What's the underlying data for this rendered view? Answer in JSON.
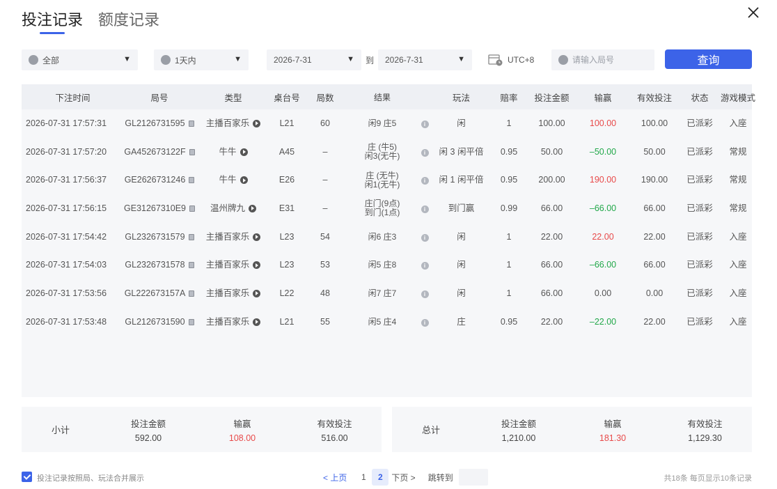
{
  "tabs": [
    {
      "label": "投注记录",
      "active": true
    },
    {
      "label": "额度记录",
      "active": false
    }
  ],
  "filters": {
    "scope": "全部",
    "range": "1天内",
    "start_date": "2026-7-31",
    "to_label": "到",
    "end_date": "2026-7-31",
    "timezone": "UTC+8",
    "search_placeholder": "请输入局号",
    "query_label": "查询"
  },
  "table": {
    "columns": [
      "下注时间",
      "局号",
      "类型",
      "桌台号",
      "局数",
      "结果",
      "玩法",
      "赔率",
      "投注金额",
      "输赢",
      "有效投注",
      "状态",
      "游戏模式"
    ],
    "rows": [
      {
        "time": "2026-07-31 17:57:31",
        "round": "GL2126731595",
        "type": "主播百家乐",
        "table": "L21",
        "count": "60",
        "result1": "闲9 庄5",
        "result2": "",
        "play": "闲",
        "odds": "1",
        "bet": "100.00",
        "win": "100.00",
        "win_color": "red",
        "valid": "100.00",
        "status": "已派彩",
        "mode": "入座"
      },
      {
        "time": "2026-07-31 17:57:20",
        "round": "GA452673122F",
        "type": "牛牛",
        "table": "A45",
        "count": "–",
        "result1": "庄 (牛5)",
        "result2": "闲3(无牛)",
        "play": "闲 3 闲平倍",
        "odds": "0.95",
        "bet": "50.00",
        "win": "–50.00",
        "win_color": "green",
        "valid": "50.00",
        "status": "已派彩",
        "mode": "常规"
      },
      {
        "time": "2026-07-31 17:56:37",
        "round": "GE2626731246",
        "type": "牛牛",
        "table": "E26",
        "count": "–",
        "result1": "庄 (无牛)",
        "result2": "闲1(无牛)",
        "play": "闲 1 闲平倍",
        "odds": "0.95",
        "bet": "200.00",
        "win": "190.00",
        "win_color": "red",
        "valid": "190.00",
        "status": "已派彩",
        "mode": "常规"
      },
      {
        "time": "2026-07-31 17:56:15",
        "round": "GE31267310E9",
        "type": "温州牌九",
        "table": "E31",
        "count": "–",
        "result1": "庄门(9点)",
        "result2": "到门(1点)",
        "play": "到门赢",
        "odds": "0.99",
        "bet": "66.00",
        "win": "–66.00",
        "win_color": "green",
        "valid": "66.00",
        "status": "已派彩",
        "mode": "常规"
      },
      {
        "time": "2026-07-31 17:54:42",
        "round": "GL2326731579",
        "type": "主播百家乐",
        "table": "L23",
        "count": "54",
        "result1": "闲6 庄3",
        "result2": "",
        "play": "闲",
        "odds": "1",
        "bet": "22.00",
        "win": "22.00",
        "win_color": "red",
        "valid": "22.00",
        "status": "已派彩",
        "mode": "入座"
      },
      {
        "time": "2026-07-31 17:54:03",
        "round": "GL2326731578",
        "type": "主播百家乐",
        "table": "L23",
        "count": "53",
        "result1": "闲5 庄8",
        "result2": "",
        "play": "闲",
        "odds": "1",
        "bet": "66.00",
        "win": "–66.00",
        "win_color": "green",
        "valid": "66.00",
        "status": "已派彩",
        "mode": "入座"
      },
      {
        "time": "2026-07-31 17:53:56",
        "round": "GL222673157A",
        "type": "主播百家乐",
        "table": "L22",
        "count": "48",
        "result1": "闲7 庄7",
        "result2": "",
        "play": "闲",
        "odds": "1",
        "bet": "66.00",
        "win": "0.00",
        "win_color": "",
        "valid": "0.00",
        "status": "已派彩",
        "mode": "入座"
      },
      {
        "time": "2026-07-31 17:53:48",
        "round": "GL2126731590",
        "type": "主播百家乐",
        "table": "L21",
        "count": "55",
        "result1": "闲5 庄4",
        "result2": "",
        "play": "庄",
        "odds": "0.95",
        "bet": "22.00",
        "win": "–22.00",
        "win_color": "green",
        "valid": "22.00",
        "status": "已派彩",
        "mode": "入座"
      }
    ]
  },
  "subtotal": {
    "label": "小计",
    "bet_label": "投注金额",
    "bet": "592.00",
    "win_label": "输赢",
    "win": "108.00",
    "valid_label": "有效投注",
    "valid": "516.00"
  },
  "total": {
    "label": "总计",
    "bet_label": "投注金额",
    "bet": "1,210.00",
    "win_label": "输赢",
    "win": "181.30",
    "valid_label": "有效投注",
    "valid": "1,129.30"
  },
  "footer": {
    "merge_label": "投注记录按照局、玩法合并展示",
    "prev": "< 上页",
    "pages": [
      "1",
      "2"
    ],
    "current_page": "2",
    "next": "下页 >",
    "jump_label": "跳转到",
    "count_text": "共18条  每页显示10条记录"
  },
  "colors": {
    "accent": "#3c63e8",
    "loss": "#22a84a",
    "gain": "#e84a4a"
  }
}
